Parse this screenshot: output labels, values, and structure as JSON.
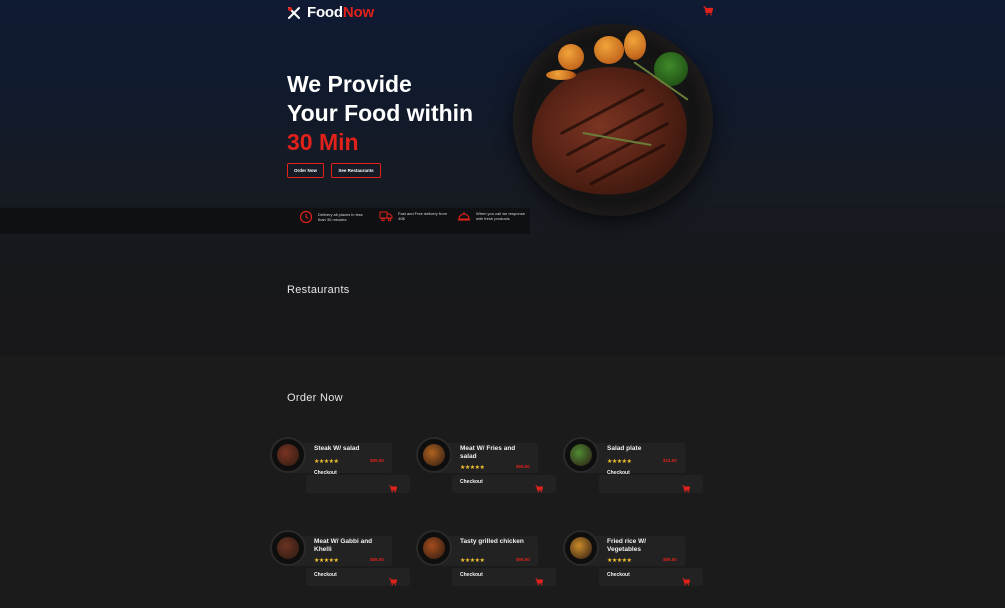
{
  "brand": {
    "name_part1": "Food",
    "name_part2": "Now",
    "accent_color": "#e0221b"
  },
  "header": {
    "cart_icon": "cart-icon"
  },
  "hero": {
    "line1": "We Provide",
    "line2": "Your Food within",
    "line3": "30 Min",
    "buttons": {
      "order_now": "Order Now",
      "see_restaurants": "See Restaurants"
    }
  },
  "features": [
    {
      "icon": "clock-icon",
      "text": "Delivery all places in less than 30 minutes"
    },
    {
      "icon": "truck-icon",
      "text": "Fast and Free delivery from 40$"
    },
    {
      "icon": "cloche-icon",
      "text": "When you call we response with fresh products"
    }
  ],
  "sections": {
    "restaurants": "Restaurants",
    "order_now": "Order Now"
  },
  "products": [
    {
      "name": "Steak W/ salad",
      "stars": "★★★★★",
      "price": "$55.00",
      "action": "Checkout",
      "food_color": "#7a3422"
    },
    {
      "name": "Meat W/ Fries and salad",
      "stars": "★★★★★",
      "price": "$55.00",
      "action": "Checkout",
      "food_color": "#b0621f"
    },
    {
      "name": "Salad plate",
      "stars": "★★★★★",
      "price": "$14.00",
      "action": "Checkout",
      "food_color": "#4f8a33"
    },
    {
      "name": "Meat W/ Gabbi and Khelli",
      "stars": "★★★★★",
      "price": "$55.00",
      "action": "Checkout",
      "food_color": "#6b3322"
    },
    {
      "name": "Tasty grilled chicken",
      "stars": "★★★★★",
      "price": "$55.00",
      "action": "Checkout",
      "food_color": "#a54d1c"
    },
    {
      "name": "Fried rice W/ Vegetables",
      "stars": "★★★★★",
      "price": "$55.00",
      "action": "Checkout",
      "food_color": "#c98a2a"
    }
  ]
}
